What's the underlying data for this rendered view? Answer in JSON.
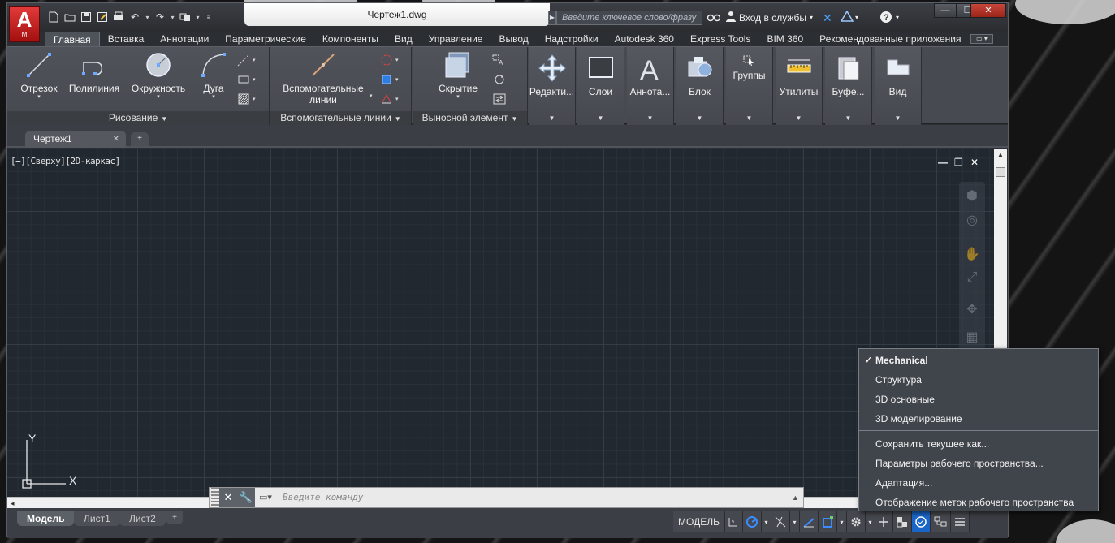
{
  "window": {
    "doc_title": "Чертеж1.dwg",
    "logo_letter": "A",
    "logo_sub": "M",
    "search_placeholder": "Введите ключевое слово/фразу",
    "signin_label": "Вход в службы",
    "minimize": "—",
    "restore": "❐",
    "close": "✕"
  },
  "ribbon_tabs": [
    "Главная",
    "Вставка",
    "Аннотации",
    "Параметрические",
    "Компоненты",
    "Вид",
    "Управление",
    "Вывод",
    "Надстройки",
    "Autodesk 360",
    "Express Tools",
    "BIM 360",
    "Рекомендованные приложения"
  ],
  "ribbon": {
    "draw_panel": {
      "title": "Рисование",
      "tools": [
        "Отрезок",
        "Полилиния",
        "Окружность",
        "Дуга"
      ]
    },
    "construction_panel": {
      "title": "Вспомогательные линии",
      "tool_line1": "Вспомогательные",
      "tool_line2": "линии"
    },
    "leader_panel": {
      "title": "Выносной элемент",
      "tool": "Скрытие"
    },
    "big_buttons": [
      "Редакти...",
      "Слои",
      "Аннота...",
      "Блок",
      "Группы",
      "Утилиты",
      "Буфе...",
      "Вид"
    ]
  },
  "doc_tabs": {
    "active": "Чертеж1",
    "close": "✕",
    "add": "+"
  },
  "viewport": {
    "label": "[−][Сверху][2D-каркас]",
    "ucs_y": "Y",
    "ucs_x": "X"
  },
  "command_line": {
    "placeholder": "Введите команду"
  },
  "layout_tabs": [
    "Модель",
    "Лист1",
    "Лист2"
  ],
  "status_bar": {
    "model_label": "МОДЕЛЬ"
  },
  "workspace_menu": {
    "items": [
      {
        "label": "Mechanical",
        "checked": true
      },
      {
        "label": "Структура",
        "checked": false
      },
      {
        "label": "3D основные",
        "checked": false
      },
      {
        "label": "3D моделирование",
        "checked": false
      }
    ],
    "actions": [
      "Сохранить текущее как...",
      "Параметры рабочего пространства...",
      "Адаптация...",
      "Отображение меток рабочего пространства"
    ]
  },
  "colors": {
    "accent_red": "#c8201c",
    "active_blue": "#1a66c8",
    "canvas_bg": "#212830"
  }
}
